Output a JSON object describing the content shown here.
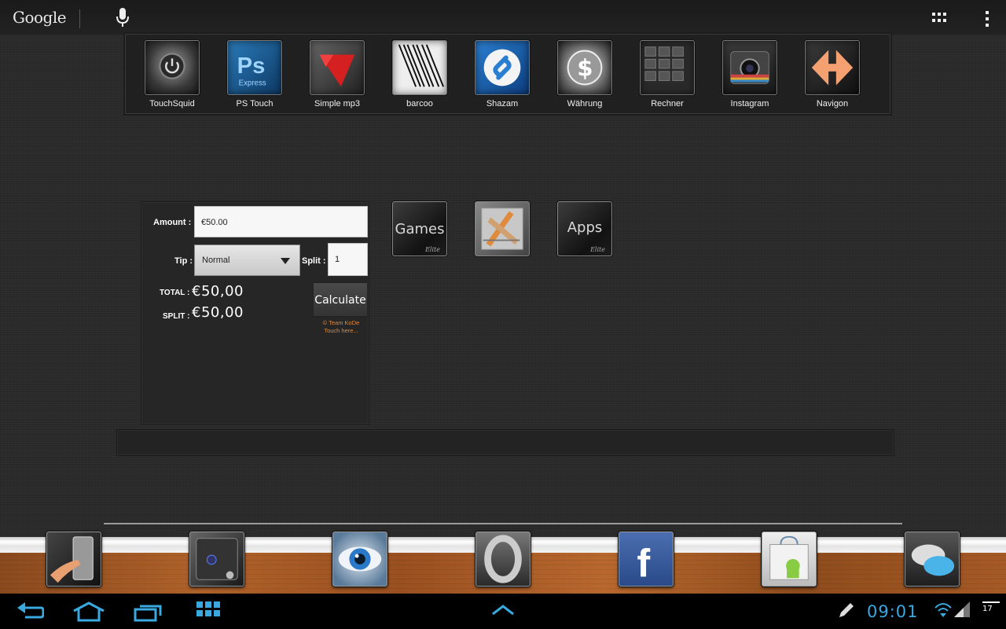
{
  "search_bar": {
    "logo_text": "Google",
    "mic_icon": "mic-icon"
  },
  "top_actions": {
    "apps_icon": "grid-icon",
    "menu_icon": "overflow-menu-icon"
  },
  "app_shelf": {
    "apps": [
      {
        "label": "TouchSquid",
        "icon": "power-button-icon"
      },
      {
        "label": "PS Touch",
        "icon": "photoshop-icon"
      },
      {
        "label": "Simple mp3",
        "icon": "red-arrow-icon"
      },
      {
        "label": "barcoo",
        "icon": "barcode-icon"
      },
      {
        "label": "Shazam",
        "icon": "shazam-icon"
      },
      {
        "label": "Währung",
        "icon": "currency-icon"
      },
      {
        "label": "Rechner",
        "icon": "calculator-icon"
      },
      {
        "label": "Instagram",
        "icon": "camera-icon"
      },
      {
        "label": "Navigon",
        "icon": "navigation-arrows-icon"
      }
    ]
  },
  "tip_calculator": {
    "amount_label": "Amount :",
    "amount_value": "€50.00",
    "tip_label": "Tip :",
    "tip_selected": "Normal",
    "split_label": "Split :",
    "split_value": "1",
    "total_label": "TOTAL :",
    "total_value": "€50,00",
    "split_result_label": "SPLIT :",
    "split_result_value": "€50,00",
    "calculate_label": "Calculate",
    "credit_line1": "© Team KoDe",
    "credit_line2": "Touch here..."
  },
  "folders": [
    {
      "text": "Games",
      "signature": "Elite"
    },
    {
      "text": "",
      "signature": ""
    },
    {
      "text": "Apps",
      "signature": "Elite"
    }
  ],
  "dock": {
    "icons": [
      "hand-touch-icon",
      "device-icon",
      "eye-icon",
      "opera-icon",
      "facebook-icon",
      "market-bag-icon",
      "chat-bubbles-icon"
    ]
  },
  "system_bar": {
    "back_icon": "back-icon",
    "home_icon": "home-icon",
    "recents_icon": "recents-icon",
    "app_drawer_icon": "app-grid-icon",
    "up_icon": "chevron-up-icon",
    "clock": "09:01",
    "battery_text": "17"
  },
  "colors": {
    "accent_blue": "#39a9e0",
    "credit_orange": "#e08a3c"
  }
}
